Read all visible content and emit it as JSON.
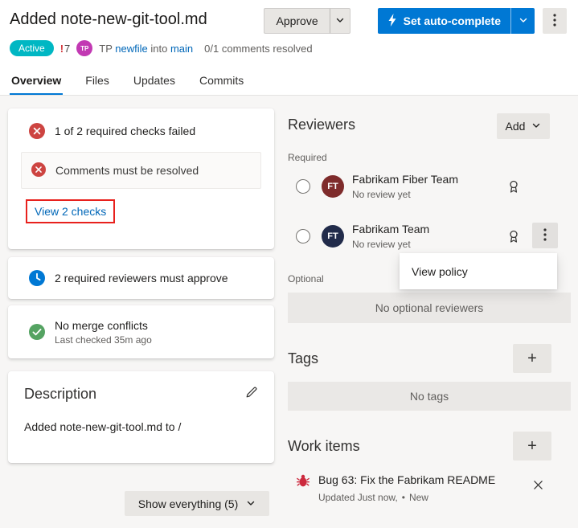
{
  "colors": {
    "accent_blue": "#0078d4",
    "error_red": "#cd4441",
    "success_green": "#55a362",
    "info_blue": "#0078d4",
    "status_badge_teal": "#00b7c3",
    "author_avatar_purple": "#c239b3",
    "fiber_team_avatar_maroon": "#7e2b2b",
    "fabrikam_team_avatar_navy": "#212b4a",
    "annotation_red": "#e8211d",
    "bug_icon_red": "#cc293d",
    "link_blue": "#0067b8"
  },
  "header": {
    "title": "Added note-new-git-tool.md",
    "approve_button": "Approve",
    "set_auto_complete_button": "Set auto-complete"
  },
  "meta": {
    "status_badge": "Active",
    "alert_mark": "!",
    "alert_count": "7",
    "avatar_initials": "TP",
    "author_label": "TP",
    "source_branch": "newfile",
    "into_text": "into",
    "target_branch": "main",
    "comments_resolved": "0/1 comments resolved"
  },
  "tabs": [
    {
      "label": "Overview"
    },
    {
      "label": "Files"
    },
    {
      "label": "Updates"
    },
    {
      "label": "Commits"
    }
  ],
  "checks_card": {
    "summary": "1 of 2 required checks failed",
    "failed_check": "Comments must be resolved",
    "view_link": "View 2 checks"
  },
  "reviewers_check_card": {
    "text": "2 required reviewers must approve"
  },
  "merge_card": {
    "status": "No merge conflicts",
    "detail": "Last checked 35m ago"
  },
  "description_card": {
    "heading": "Description",
    "body": "Added note-new-git-tool.md to /"
  },
  "show_everything_button": "Show everything (5)",
  "reviewers": {
    "heading": "Reviewers",
    "add_button": "Add",
    "required_label": "Required",
    "optional_label": "Optional",
    "no_optional_text": "No optional reviewers",
    "items": [
      {
        "initials": "FT",
        "name": "Fabrikam Fiber Team",
        "status": "No review yet"
      },
      {
        "initials": "FT",
        "name": "Fabrikam Team",
        "status": "No review yet"
      }
    ],
    "context_menu": {
      "view_policy": "View policy"
    }
  },
  "tags": {
    "heading": "Tags",
    "empty_text": "No tags"
  },
  "work_items": {
    "heading": "Work items",
    "item": {
      "title": "Bug 63: Fix the Fabrikam README",
      "updated": "Updated Just now,",
      "state_bullet": "•",
      "state": "New"
    }
  },
  "icons": {
    "plus": "+"
  }
}
